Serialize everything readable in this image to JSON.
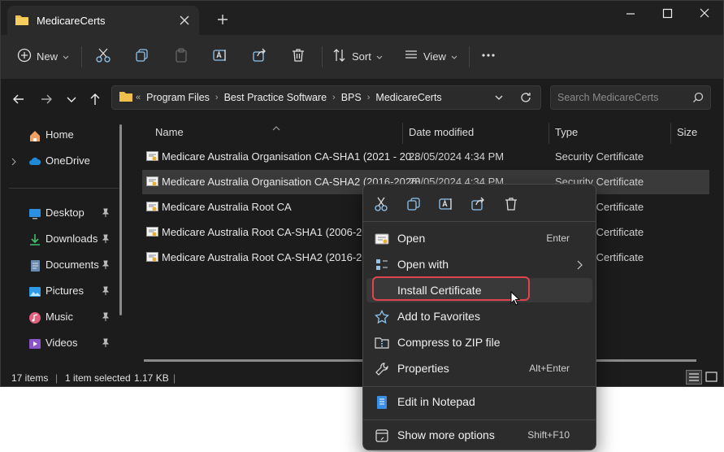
{
  "window": {
    "tab_title": "MedicareCerts",
    "folder_color": "#f0c04a",
    "accent": "#4cc2ff"
  },
  "toolbar": {
    "new_label": "New",
    "sort_label": "Sort",
    "view_label": "View"
  },
  "address": {
    "overflow": "«",
    "crumbs": [
      "Program Files",
      "Best Practice Software",
      "BPS",
      "MedicareCerts"
    ],
    "search_placeholder": "Search MedicareCerts"
  },
  "sidebar": {
    "items": [
      {
        "label": "Home",
        "icon": "home-icon"
      },
      {
        "label": "OneDrive",
        "icon": "cloud-icon"
      },
      {
        "label": "Desktop",
        "icon": "desktop-icon"
      },
      {
        "label": "Downloads",
        "icon": "download-icon"
      },
      {
        "label": "Documents",
        "icon": "document-icon"
      },
      {
        "label": "Pictures",
        "icon": "picture-icon"
      },
      {
        "label": "Music",
        "icon": "music-icon"
      },
      {
        "label": "Videos",
        "icon": "video-icon"
      }
    ]
  },
  "columns": {
    "name": "Name",
    "date": "Date modified",
    "type": "Type",
    "size": "Size"
  },
  "files": [
    {
      "name": "Medicare Australia Organisation CA-SHA1 (2021 - 20...",
      "date": "28/05/2024 4:34 PM",
      "type": "Security Certificate"
    },
    {
      "name": "Medicare Australia Organisation CA-SHA2 (2016-2026)",
      "date": "28/05/2024 4:34 PM",
      "type": "Security Certificate"
    },
    {
      "name": "Medicare Australia Root CA",
      "date": "",
      "type": "Security Certificate"
    },
    {
      "name": "Medicare Australia Root CA-SHA1 (2006-2026)",
      "date": "",
      "type": "Security Certificate"
    },
    {
      "name": "Medicare Australia Root CA-SHA2 (2016-2036)",
      "date": "",
      "type": "Security Certificate"
    }
  ],
  "status": {
    "count": "17 items",
    "selected": "1 item selected",
    "size": "1.17 KB"
  },
  "context_menu": {
    "items": [
      {
        "label": "Open",
        "shortcut": "Enter",
        "icon": "open-icon"
      },
      {
        "label": "Open with",
        "shortcut": "",
        "icon": "open-with-icon"
      },
      {
        "label": "Install Certificate",
        "shortcut": "",
        "icon": ""
      },
      {
        "label": "Add to Favorites",
        "shortcut": "",
        "icon": "star-icon"
      },
      {
        "label": "Compress to ZIP file",
        "shortcut": "",
        "icon": "zip-icon"
      },
      {
        "label": "Properties",
        "shortcut": "Alt+Enter",
        "icon": "wrench-icon"
      },
      {
        "label": "Edit in Notepad",
        "shortcut": "",
        "icon": "notepad-icon"
      },
      {
        "label": "Show more options",
        "shortcut": "Shift+F10",
        "icon": "more-options-icon"
      }
    ],
    "highlight_color": "#e0454e"
  }
}
